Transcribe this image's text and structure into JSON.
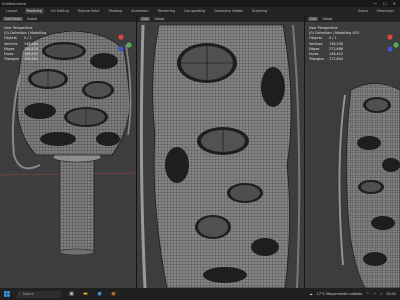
{
  "window": {
    "title": "Untitled.blend",
    "controls": [
      "—",
      "☐",
      "✕"
    ]
  },
  "menu": {
    "workspaces": [
      "Layout",
      "Modeling",
      "UV Editing",
      "Texture Paint",
      "Shading",
      "Animation",
      "Rendering",
      "Compositing",
      "Geometry Nodes",
      "Scripting"
    ],
    "active_workspace": "Modeling",
    "scene_label": "Scene",
    "layer_label": "ViewLayer"
  },
  "viewports": {
    "left": {
      "mode": "Edit Mode",
      "view": "Global",
      "perspective": "User Perspective",
      "collection": "(0) Collection | Modelling"
    },
    "middle": {
      "mode": "Edit",
      "view": "Global",
      "perspective": "User Perspective",
      "collection": "(0) Collection | Modelling"
    },
    "right": {
      "mode": "Edit",
      "view": "Global",
      "perspective": "User Perspective",
      "collection": "(0) Collection | Modelling 003"
    }
  },
  "stats": {
    "left": [
      [
        "Objects",
        "0 / 1"
      ],
      [
        "Vertices",
        "148,284"
      ],
      [
        "Edges",
        "296,816"
      ],
      [
        "Faces",
        "148,402"
      ],
      [
        "Triangles",
        "296,804"
      ]
    ],
    "right": [
      [
        "Objects",
        "0 / 1"
      ],
      [
        "Vertices",
        "136,258"
      ],
      [
        "Edges",
        "272,688"
      ],
      [
        "Faces",
        "136,422"
      ],
      [
        "Triangles",
        "272,844"
      ]
    ]
  },
  "taskbar": {
    "search_placeholder": "Search",
    "weather": "17°C  Mayormente nublado",
    "time": "10:42"
  },
  "colors": {
    "viewport_bg": "#3d3d3d",
    "mesh_wire": "#1e1e1e",
    "mesh_face": "#8a8a8a",
    "grid": "#4a4a4a"
  }
}
